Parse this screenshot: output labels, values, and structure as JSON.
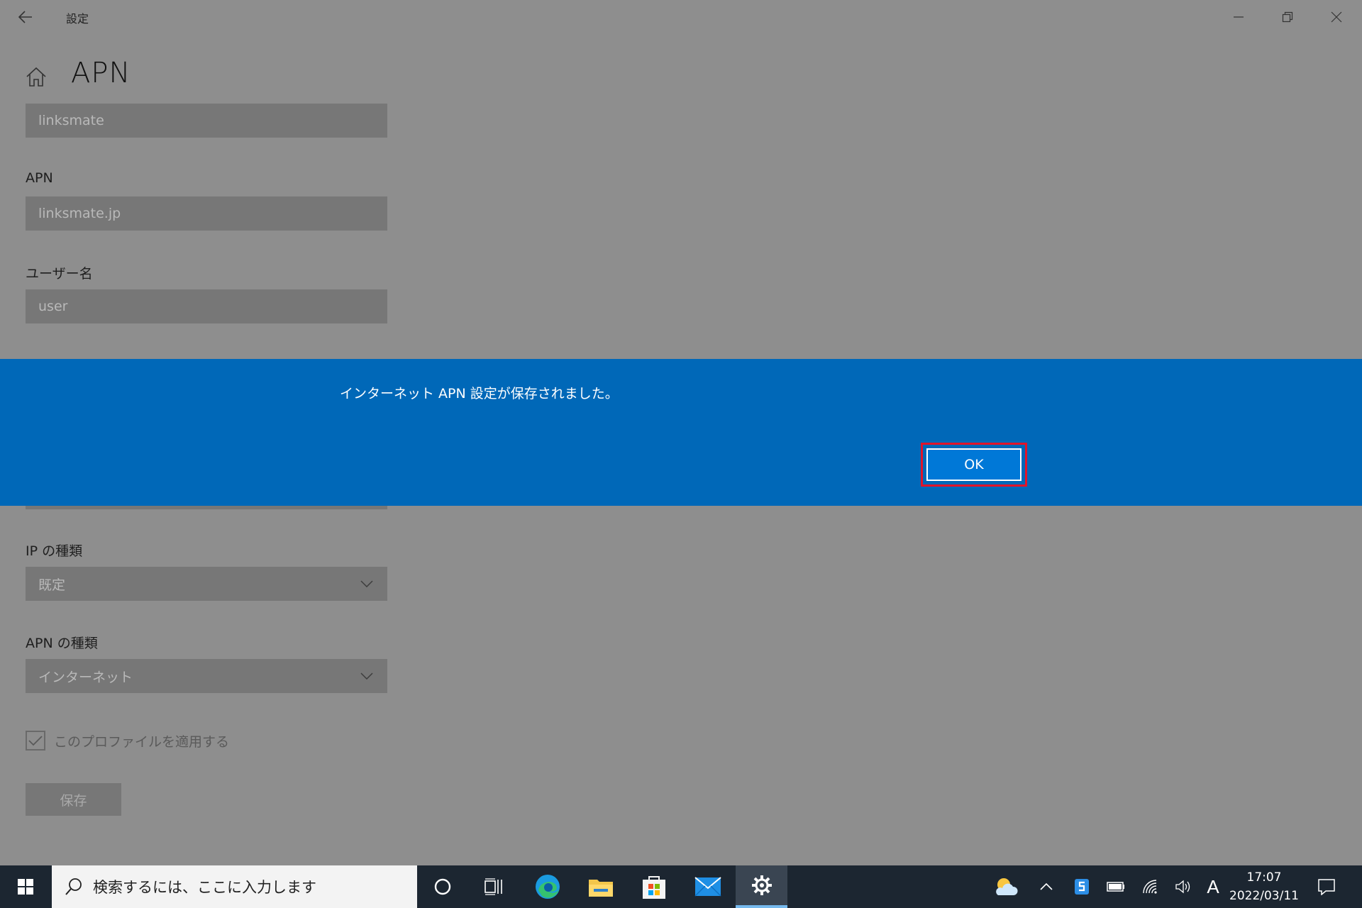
{
  "window": {
    "title": "設定",
    "back_icon": "arrow-left-icon",
    "controls": [
      "minimize-icon",
      "restore-icon",
      "close-icon"
    ]
  },
  "page": {
    "title": "APN",
    "home_icon": "home-icon"
  },
  "form": {
    "profile_name_value": "linksmate",
    "apn_label": "APN",
    "apn_value": "linksmate.jp",
    "username_label": "ユーザー名",
    "username_value": "user",
    "ip_type_label": "IP の種類",
    "ip_type_value": "既定",
    "apn_type_label": "APN の種類",
    "apn_type_value": "インターネット",
    "apply_profile_label": "このプロファイルを適用する",
    "apply_profile_checked": true,
    "save_label": "保存"
  },
  "dialog": {
    "message": "インターネット APN 設定が保存されました。",
    "ok_label": "OK",
    "background": "#0068b8",
    "highlight_color": "#e0142a"
  },
  "taskbar": {
    "search_placeholder": "検索するには、ここに入力します",
    "time": "17:07",
    "date": "2022/03/11",
    "ime_indicator": "A",
    "apps": [
      "start-icon",
      "cortana-icon",
      "task-view-icon",
      "edge-icon",
      "file-explorer-icon",
      "store-icon",
      "mail-icon",
      "settings-icon"
    ],
    "tray": [
      "weather-icon",
      "chevron-up-icon",
      "security-icon",
      "battery-icon",
      "wifi-icon",
      "volume-icon",
      "notification-icon"
    ]
  }
}
